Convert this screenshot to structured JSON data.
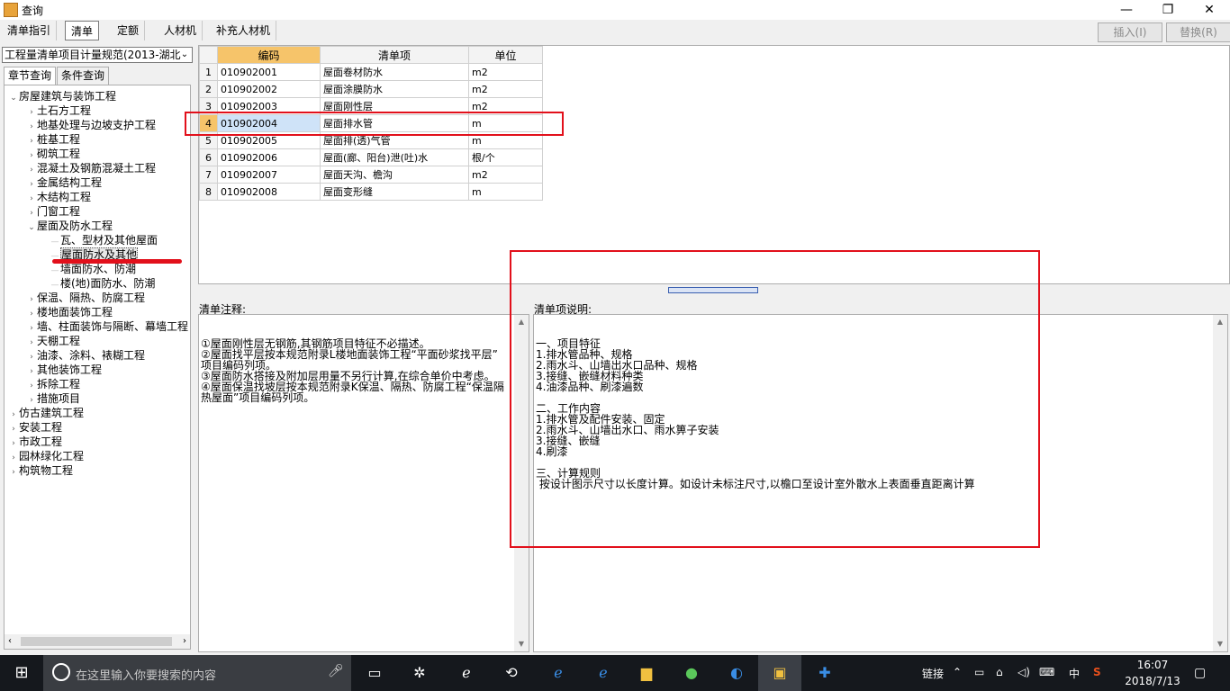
{
  "window": {
    "title": "查询",
    "minimize_glyph": "—",
    "restore_glyph": "❐",
    "close_glyph": "✕"
  },
  "tabs": [
    "清单指引",
    "清单",
    "定额",
    "人材机",
    "补充人材机"
  ],
  "active_tab": "清单",
  "toolbar": {
    "insert_label": "插入(I)",
    "replace_label": "替换(R)"
  },
  "left": {
    "spec_select_value": "工程量清单项目计量规范(2013-湖北",
    "tabs": [
      "章节查询",
      "条件查询"
    ],
    "tree": [
      {
        "label": "房屋建筑与装饰工程",
        "level": 0,
        "expanded": true
      },
      {
        "label": "土石方工程",
        "level": 1
      },
      {
        "label": "地基处理与边坡支护工程",
        "level": 1
      },
      {
        "label": "桩基工程",
        "level": 1
      },
      {
        "label": "砌筑工程",
        "level": 1
      },
      {
        "label": "混凝土及钢筋混凝土工程",
        "level": 1
      },
      {
        "label": "金属结构工程",
        "level": 1
      },
      {
        "label": "木结构工程",
        "level": 1
      },
      {
        "label": "门窗工程",
        "level": 1
      },
      {
        "label": "屋面及防水工程",
        "level": 1,
        "expanded": true
      },
      {
        "label": "瓦、型材及其他屋面",
        "level": 2
      },
      {
        "label": "屋面防水及其他",
        "level": 2,
        "selected": true
      },
      {
        "label": "墙面防水、防潮",
        "level": 2
      },
      {
        "label": "楼(地)面防水、防潮",
        "level": 2
      },
      {
        "label": "保温、隔热、防腐工程",
        "level": 1
      },
      {
        "label": "楼地面装饰工程",
        "level": 1
      },
      {
        "label": "墙、柱面装饰与隔断、幕墙工程",
        "level": 1
      },
      {
        "label": "天棚工程",
        "level": 1
      },
      {
        "label": "油漆、涂料、裱糊工程",
        "level": 1
      },
      {
        "label": "其他装饰工程",
        "level": 1
      },
      {
        "label": "拆除工程",
        "level": 1
      },
      {
        "label": "措施项目",
        "level": 1
      },
      {
        "label": "仿古建筑工程",
        "level": 0
      },
      {
        "label": "安装工程",
        "level": 0
      },
      {
        "label": "市政工程",
        "level": 0
      },
      {
        "label": "园林绿化工程",
        "level": 0
      },
      {
        "label": "构筑物工程",
        "level": 0
      }
    ]
  },
  "grid": {
    "columns": [
      "编码",
      "清单项",
      "单位"
    ],
    "rows": [
      {
        "n": "1",
        "code": "010902001",
        "name": "屋面卷材防水",
        "unit": "m2"
      },
      {
        "n": "2",
        "code": "010902002",
        "name": "屋面涂膜防水",
        "unit": "m2"
      },
      {
        "n": "3",
        "code": "010902003",
        "name": "屋面刚性层",
        "unit": "m2"
      },
      {
        "n": "4",
        "code": "010902004",
        "name": "屋面排水管",
        "unit": "m",
        "selected": true
      },
      {
        "n": "5",
        "code": "010902005",
        "name": "屋面排(透)气管",
        "unit": "m"
      },
      {
        "n": "6",
        "code": "010902006",
        "name": "屋面(廊、阳台)泄(吐)水",
        "unit": "根/个"
      },
      {
        "n": "7",
        "code": "010902007",
        "name": "屋面天沟、檐沟",
        "unit": "m2"
      },
      {
        "n": "8",
        "code": "010902008",
        "name": "屋面变形缝",
        "unit": "m"
      }
    ]
  },
  "notes": {
    "label": "清单注释:",
    "text": "①屋面刚性层无钢筋,其钢筋项目特征不必描述。\n②屋面找平层按本规范附录L楼地面装饰工程“平面砂浆找平层”\n项目编码列项。\n③屋面防水搭接及附加层用量不另行计算,在综合单价中考虑。\n④屋面保温找坡层按本规范附录K保温、隔热、防腐工程“保温隔\n热屋面”项目编码列项。"
  },
  "description": {
    "label": "清单项说明:",
    "text": "一、项目特征\n1.排水管品种、规格\n2.雨水斗、山墙出水口品种、规格\n3.接缝、嵌缝材料种类\n4.油漆品种、刷漆遍数\n\n二、工作内容\n1.排水管及配件安装、固定\n2.雨水斗、山墙出水口、雨水箅子安装\n3.接缝、嵌缝\n4.刷漆\n\n三、计算规则\n 按设计图示尺寸以长度计算。如设计未标注尺寸,以檐口至设计室外散水上表面垂直距离计算"
  },
  "taskbar": {
    "search_placeholder": "在这里输入你要搜索的内容",
    "tray_link": "链接",
    "ime": "中",
    "time": "16:07",
    "date": "2018/7/13"
  },
  "colors": {
    "active_header": "#f6c46a",
    "annotation_red": "#e2101b",
    "selection": "#cfe3f8"
  }
}
